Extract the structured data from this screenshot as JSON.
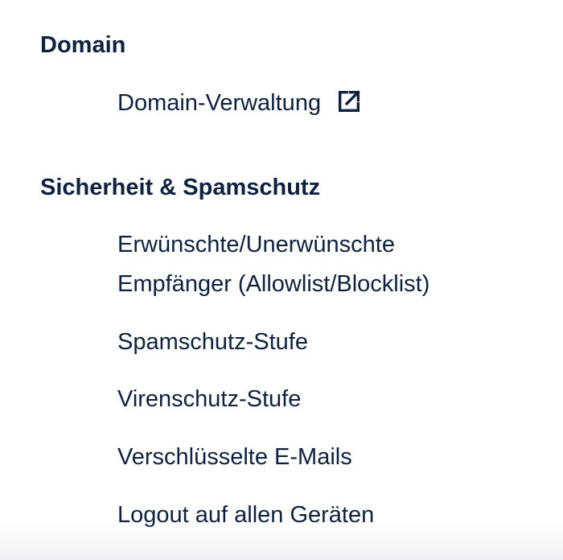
{
  "sections": {
    "domain": {
      "heading": "Domain",
      "items": [
        {
          "label": "Domain-Verwaltung",
          "icon": "external-link-icon"
        }
      ]
    },
    "security": {
      "heading": "Sicherheit & Spamschutz",
      "items": [
        {
          "label": "Erwünschte/Unerwünschte Empfänger (Allowlist/Blocklist)"
        },
        {
          "label": "Spamschutz-Stufe"
        },
        {
          "label": "Virenschutz-Stufe"
        },
        {
          "label": "Verschlüsselte E-Mails"
        },
        {
          "label": "Logout auf allen Geräten"
        }
      ]
    }
  },
  "colors": {
    "text": "#0e2240",
    "background": "#ffffff"
  }
}
